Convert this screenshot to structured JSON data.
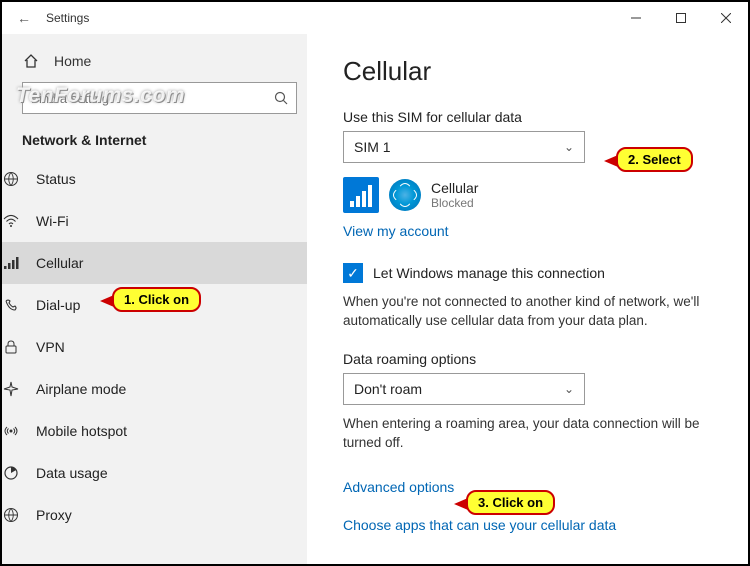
{
  "titlebar": {
    "back": "←",
    "title": "Settings"
  },
  "sidebar": {
    "home": "Home",
    "search_placeholder": "Find a setting",
    "category": "Network & Internet",
    "items": [
      {
        "label": "Status"
      },
      {
        "label": "Wi-Fi"
      },
      {
        "label": "Cellular"
      },
      {
        "label": "Dial-up"
      },
      {
        "label": "VPN"
      },
      {
        "label": "Airplane mode"
      },
      {
        "label": "Mobile hotspot"
      },
      {
        "label": "Data usage"
      },
      {
        "label": "Proxy"
      }
    ]
  },
  "content": {
    "heading": "Cellular",
    "sim_label": "Use this SIM for cellular data",
    "sim_value": "SIM 1",
    "network_name": "Cellular",
    "network_status": "Blocked",
    "view_account": "View my account",
    "manage_checkbox": "Let Windows manage this connection",
    "manage_desc": "When you're not connected to another kind of network, we'll automatically use cellular data from your data plan.",
    "roaming_label": "Data roaming options",
    "roaming_value": "Don't roam",
    "roaming_desc": "When entering a roaming area, your data connection will be turned off.",
    "advanced": "Advanced options",
    "choose_apps": "Choose apps that can use your cellular data"
  },
  "callouts": {
    "c1": "1. Click on",
    "c2": "2. Select",
    "c3": "3. Click on"
  },
  "watermark": "TenForums.com"
}
